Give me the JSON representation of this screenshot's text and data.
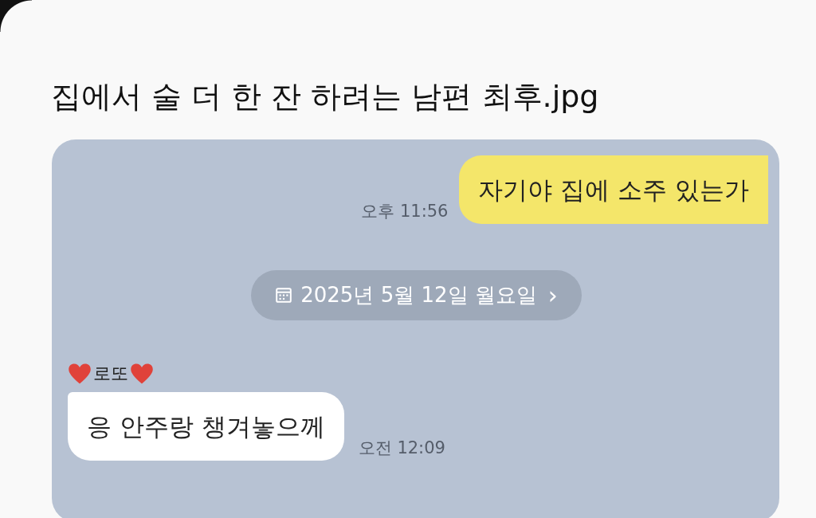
{
  "post": {
    "title": "집에서 술 더 한 잔 하려는 남편 최후.jpg"
  },
  "chat": {
    "messages": [
      {
        "kind": "sent",
        "text": "자기야 집에 소주 있는가",
        "time": "오후 11:56"
      },
      {
        "kind": "date",
        "text": "2025년 5월 12일 월요일",
        "arrow": "›"
      },
      {
        "kind": "received",
        "sender": "로또",
        "text": "응 안주랑 챙겨놓으께",
        "time": "오전 12:09"
      }
    ]
  }
}
